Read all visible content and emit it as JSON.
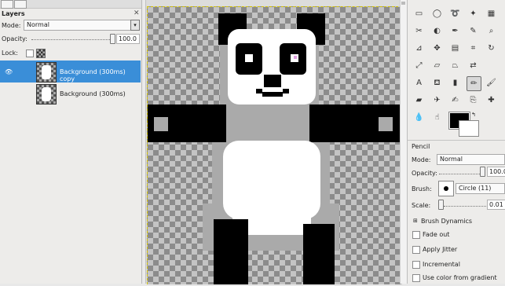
{
  "layers_panel": {
    "title": "Layers",
    "mode_label": "Mode:",
    "mode_value": "Normal",
    "opacity_label": "Opacity:",
    "opacity_value": "100.0",
    "lock_label": "Lock:",
    "layers": [
      {
        "name": "Background (300ms) copy",
        "selected": true,
        "visible": true
      },
      {
        "name": "Background (300ms)",
        "selected": false,
        "visible": false
      }
    ]
  },
  "tool_options": {
    "title": "Pencil",
    "mode_label": "Mode:",
    "mode_value": "Normal",
    "opacity_label": "Opacity:",
    "opacity_value": "100.0",
    "brush_label": "Brush:",
    "brush_value": "Circle (11)",
    "scale_label": "Scale:",
    "scale_value": "0.01",
    "brush_dynamics_label": "Brush Dynamics",
    "fade_out_label": "Fade out",
    "apply_jitter_label": "Apply Jitter",
    "incremental_label": "Incremental",
    "use_color_gradient_label": "Use color from gradient"
  },
  "colors": {
    "foreground": "#000000",
    "background": "#ffffff",
    "selection": "#3a8ed8"
  },
  "toolbox_icons": [
    "rect-select-icon",
    "ellipse-select-icon",
    "free-select-icon",
    "fuzzy-select-icon",
    "by-color-select-icon",
    "scissors-icon",
    "foreground-select-icon",
    "paths-icon",
    "color-picker-icon",
    "zoom-icon",
    "measure-icon",
    "move-icon",
    "align-icon",
    "crop-icon",
    "rotate-icon",
    "scale-icon",
    "shear-icon",
    "perspective-icon",
    "flip-icon",
    "text-icon",
    "bucket-fill-icon",
    "blend-icon",
    "pencil-icon",
    "paintbrush-icon",
    "eraser-icon",
    "airbrush-icon",
    "ink-icon",
    "clone-icon",
    "heal-icon",
    "perspective-clone-icon",
    "blur-icon",
    "smudge-icon",
    "dodge-burn-icon"
  ]
}
